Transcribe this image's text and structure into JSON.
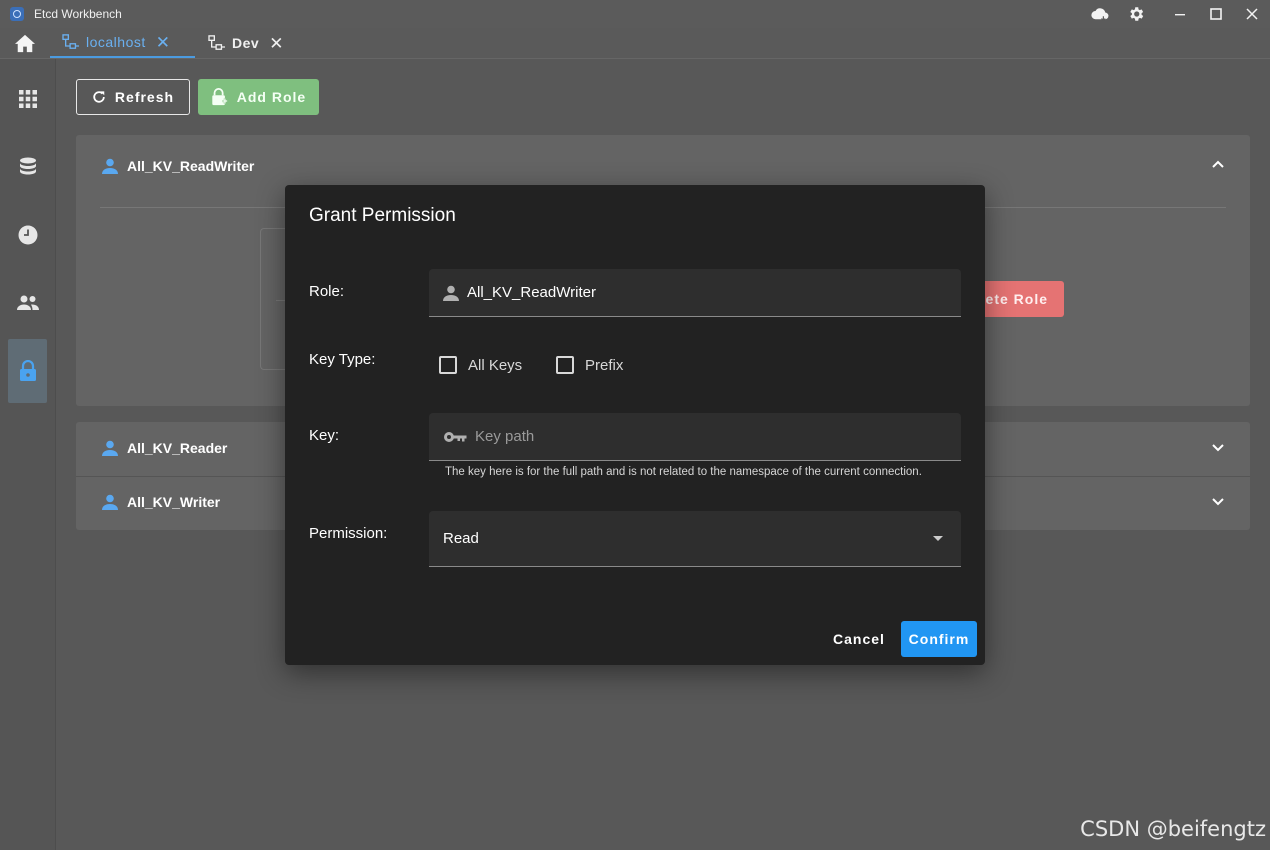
{
  "window": {
    "title": "Etcd Workbench",
    "controls": [
      "cloud-download-icon",
      "settings-icon",
      "minimize-icon",
      "maximize-icon",
      "close-icon"
    ]
  },
  "tabs": [
    {
      "label": "localhost",
      "active": true
    },
    {
      "label": "Dev",
      "active": false
    }
  ],
  "sidebar": {
    "items": [
      "apps-grid-icon",
      "database-icon",
      "clock-icon",
      "users-icon",
      "lock-icon"
    ],
    "active_index": 4
  },
  "toolbar": {
    "refresh_label": "Refresh",
    "add_role_label": "Add Role"
  },
  "roles": [
    {
      "name": "All_KV_ReadWriter",
      "expanded": true
    },
    {
      "name": "All_KV_Reader",
      "expanded": false
    },
    {
      "name": "All_KV_Writer",
      "expanded": false
    }
  ],
  "delete_role_label": "ete Role",
  "dialog": {
    "title": "Grant Permission",
    "role_label": "Role:",
    "role_value": "All_KV_ReadWriter",
    "key_type_label": "Key Type:",
    "key_type_options": [
      {
        "label": "All Keys",
        "checked": false
      },
      {
        "label": "Prefix",
        "checked": false
      }
    ],
    "key_label": "Key:",
    "key_placeholder": "Key path",
    "key_hint": "The key here is for the full path and is not related to the namespace of the current connection.",
    "permission_label": "Permission:",
    "permission_value": "Read",
    "cancel_label": "Cancel",
    "confirm_label": "Confirm"
  },
  "colors": {
    "accent": "#2196f3",
    "tab_active": "#6ab0f0",
    "add_role": "#7fbf7f",
    "delete_role": "#e57373",
    "dialog_bg": "#222222"
  },
  "watermark": "CSDN @beifengtz"
}
